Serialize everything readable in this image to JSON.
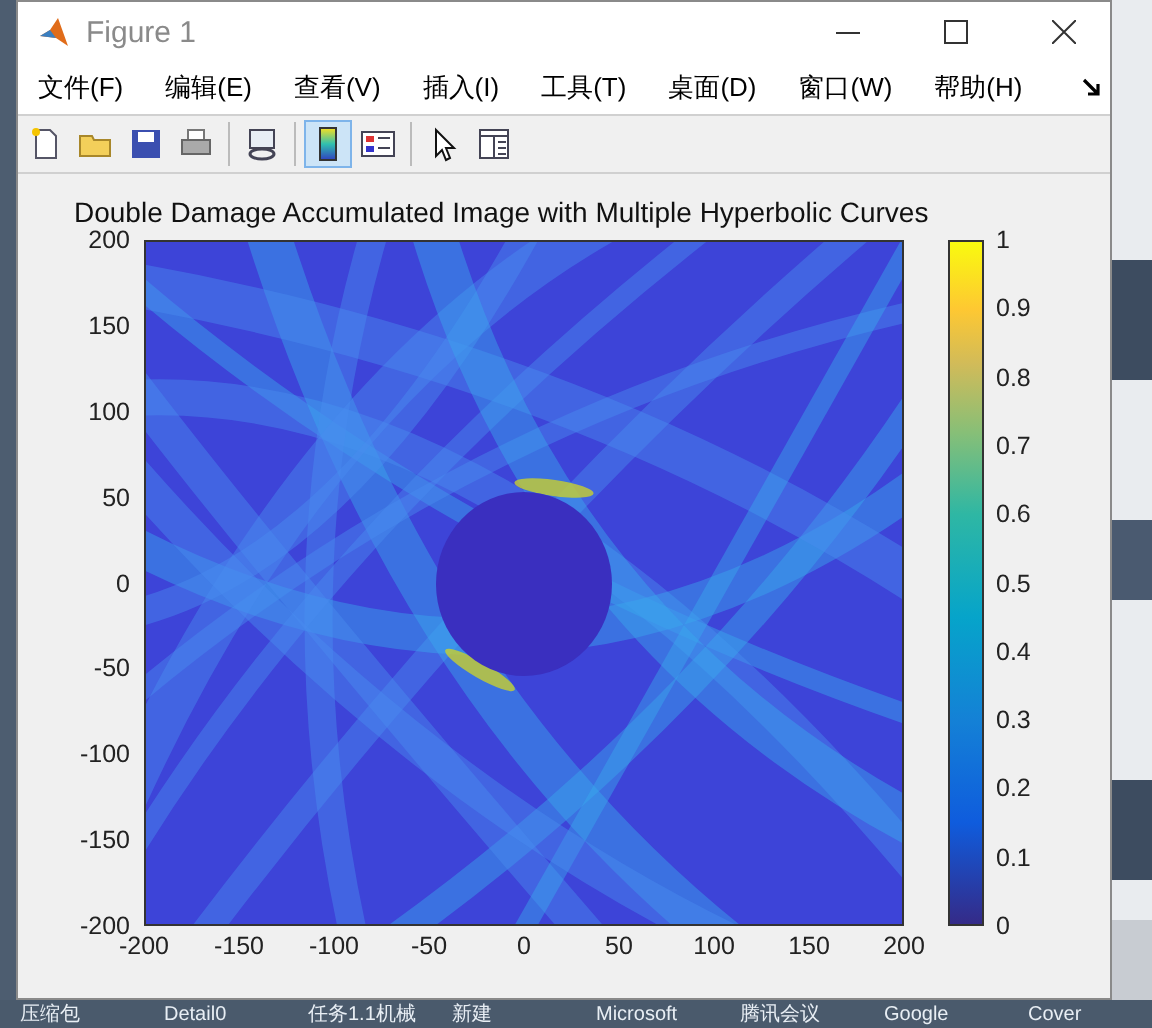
{
  "window": {
    "title": "Figure 1"
  },
  "menu": [
    "文件(F)",
    "编辑(E)",
    "查看(V)",
    "插入(I)",
    "工具(T)",
    "桌面(D)",
    "窗口(W)",
    "帮助(H)"
  ],
  "toolbar": [
    {
      "kind": "new",
      "selected": false
    },
    {
      "kind": "open",
      "selected": false
    },
    {
      "kind": "save",
      "selected": false
    },
    {
      "kind": "print",
      "selected": false
    },
    {
      "kind": "link",
      "selected": false
    },
    {
      "kind": "colorbar",
      "selected": true
    },
    {
      "kind": "legend",
      "selected": false
    },
    {
      "kind": "pointer",
      "selected": false
    },
    {
      "kind": "property",
      "selected": false
    }
  ],
  "axes": {
    "title": "Double Damage Accumulated Image with Multiple Hyperbolic Curves",
    "xticks": [
      "-200",
      "-150",
      "-100",
      "-50",
      "0",
      "50",
      "100",
      "150",
      "200"
    ],
    "yticks": [
      "200",
      "150",
      "100",
      "50",
      "0",
      "-50",
      "-100",
      "-150",
      "-200"
    ]
  },
  "colorbar": {
    "ticks": [
      "1",
      "0.9",
      "0.8",
      "0.7",
      "0.6",
      "0.5",
      "0.4",
      "0.3",
      "0.2",
      "0.1",
      "0"
    ]
  },
  "taskbar": [
    "压缩包",
    "Detail0",
    "任务1.1机械",
    "新建",
    "Microsoft",
    "腾讯会议",
    "Google",
    "Cover"
  ]
}
